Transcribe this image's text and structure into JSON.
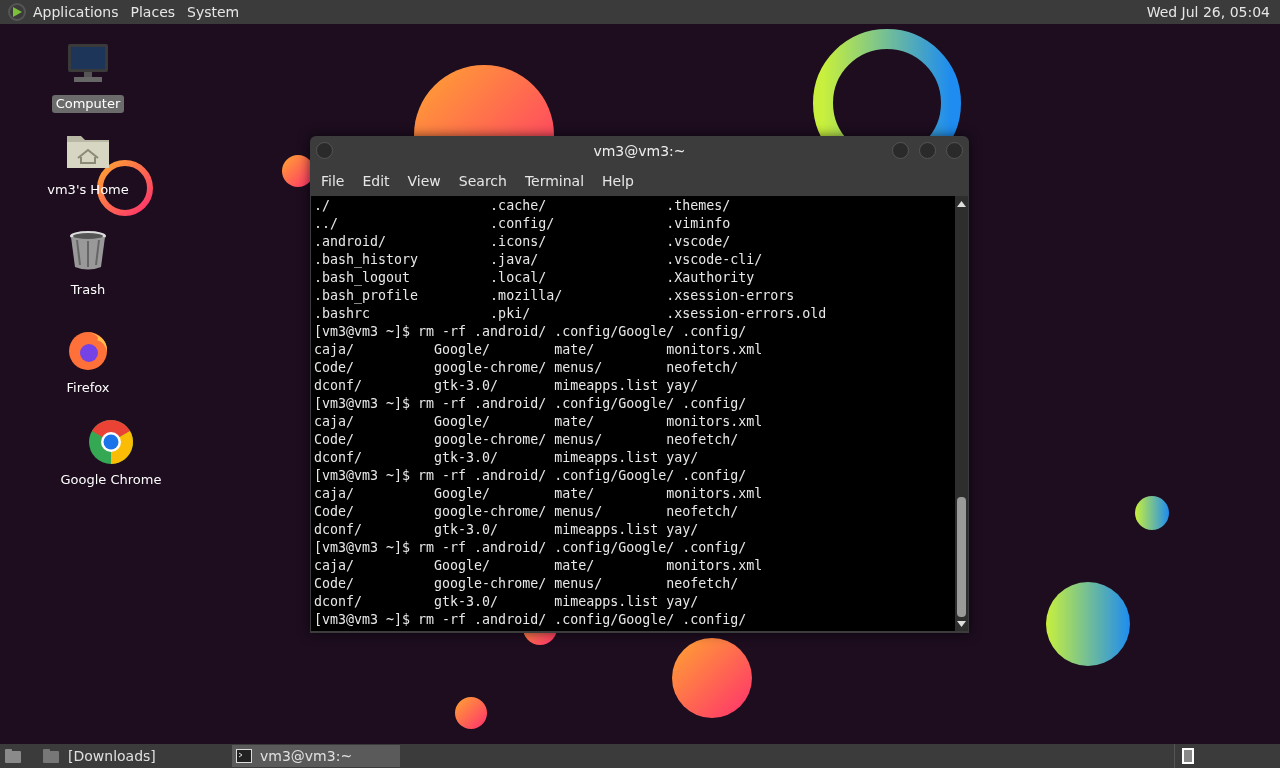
{
  "top_panel": {
    "menus": [
      "Applications",
      "Places",
      "System"
    ],
    "clock": "Wed Jul 26, 05:04"
  },
  "desktop_icons": [
    {
      "kind": "computer",
      "label": "Computer",
      "selected": true
    },
    {
      "kind": "home",
      "label": "vm3's Home",
      "selected": false
    },
    {
      "kind": "trash",
      "label": "Trash",
      "selected": false
    },
    {
      "kind": "firefox",
      "label": "Firefox",
      "selected": false
    },
    {
      "kind": "chrome",
      "label": "Google Chrome",
      "selected": false
    }
  ],
  "terminal": {
    "title": "vm3@vm3:~",
    "menu": [
      "File",
      "Edit",
      "View",
      "Search",
      "Terminal",
      "Help"
    ],
    "lines": [
      "./                    .cache/               .themes/",
      "../                   .config/              .viminfo",
      ".android/             .icons/               .vscode/",
      ".bash_history         .java/                .vscode-cli/",
      ".bash_logout          .local/               .Xauthority",
      ".bash_profile         .mozilla/             .xsession-errors",
      ".bashrc               .pki/                 .xsession-errors.old",
      "[vm3@vm3 ~]$ rm -rf .android/ .config/Google/ .config/",
      "caja/          Google/        mate/         monitors.xml",
      "Code/          google-chrome/ menus/        neofetch/",
      "dconf/         gtk-3.0/       mimeapps.list yay/",
      "[vm3@vm3 ~]$ rm -rf .android/ .config/Google/ .config/",
      "caja/          Google/        mate/         monitors.xml",
      "Code/          google-chrome/ menus/        neofetch/",
      "dconf/         gtk-3.0/       mimeapps.list yay/",
      "[vm3@vm3 ~]$ rm -rf .android/ .config/Google/ .config/",
      "caja/          Google/        mate/         monitors.xml",
      "Code/          google-chrome/ menus/        neofetch/",
      "dconf/         gtk-3.0/       mimeapps.list yay/",
      "[vm3@vm3 ~]$ rm -rf .android/ .config/Google/ .config/",
      "caja/          Google/        mate/         monitors.xml",
      "Code/          google-chrome/ menus/        neofetch/",
      "dconf/         gtk-3.0/       mimeapps.list yay/",
      "[vm3@vm3 ~]$ rm -rf .android/ .config/Google/ .config/"
    ]
  },
  "taskbar": {
    "tasks": [
      {
        "label": "[Downloads]",
        "kind": "folder",
        "selected": false
      },
      {
        "label": "vm3@vm3:~",
        "kind": "terminal",
        "selected": true
      }
    ]
  }
}
